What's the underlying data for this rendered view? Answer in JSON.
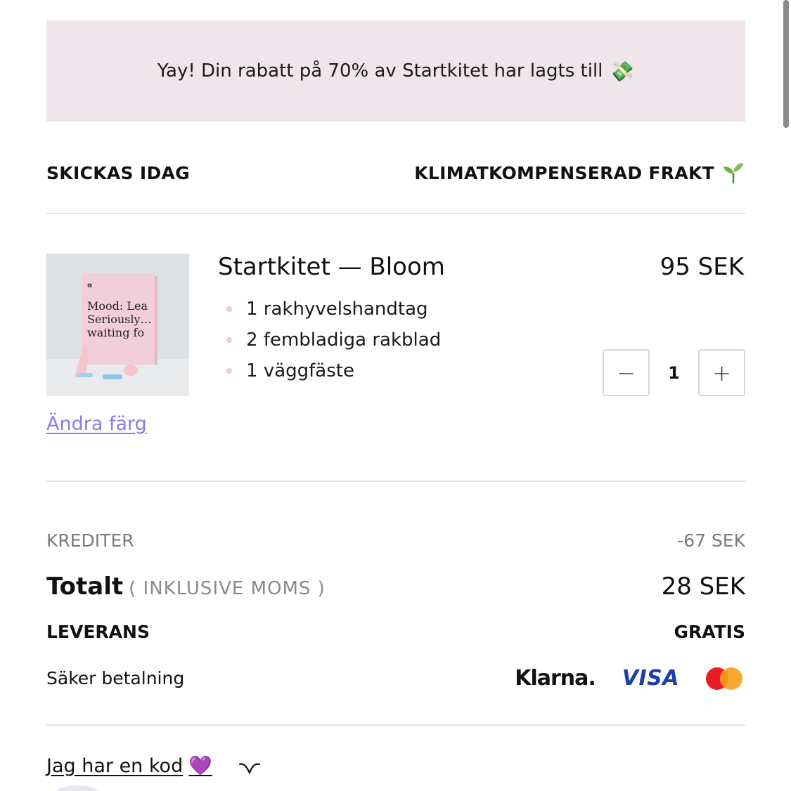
{
  "banner": {
    "text": "Yay! Din rabatt på 70% av Startkitet har lagts till",
    "icon": "money-with-wings-icon",
    "emoji": "💸"
  },
  "shipping": {
    "left_label": "SKICKAS IDAG",
    "right_label": "KLIMATKOMPENSERAD FRAKT",
    "right_icon": "seedling-icon"
  },
  "product": {
    "title": "Startkitet — Bloom",
    "price": "95 SEK",
    "image_alt": "Startkit box",
    "box_text": [
      "Mood: Lea",
      "Seriously…",
      "waiting fo"
    ],
    "features": [
      "1 rakhyvelshandtag",
      "2 fembladiga rakblad",
      "1 väggfäste"
    ],
    "quantity": "1",
    "decrement_label": "−",
    "increment_label": "+",
    "change_color_label": "Ändra färg"
  },
  "summary": {
    "credits_label": "KREDITER",
    "credits_value": "-67 SEK",
    "total_label": "Totalt",
    "total_note": "( INKLUSIVE MOMS )",
    "total_value": "28 SEK",
    "delivery_label": "LEVERANS",
    "delivery_value": "GRATIS",
    "payment_label": "Säker betalning",
    "payment_methods": [
      "Klarna.",
      "VISA",
      "mastercard"
    ]
  },
  "code": {
    "label": "Jag har en kod",
    "emoji": "💜"
  },
  "colors": {
    "banner_bg": "#f1e5ec",
    "link": "#8b7be6",
    "visa": "#1a3fa8",
    "dot": "#f3c9d2"
  }
}
